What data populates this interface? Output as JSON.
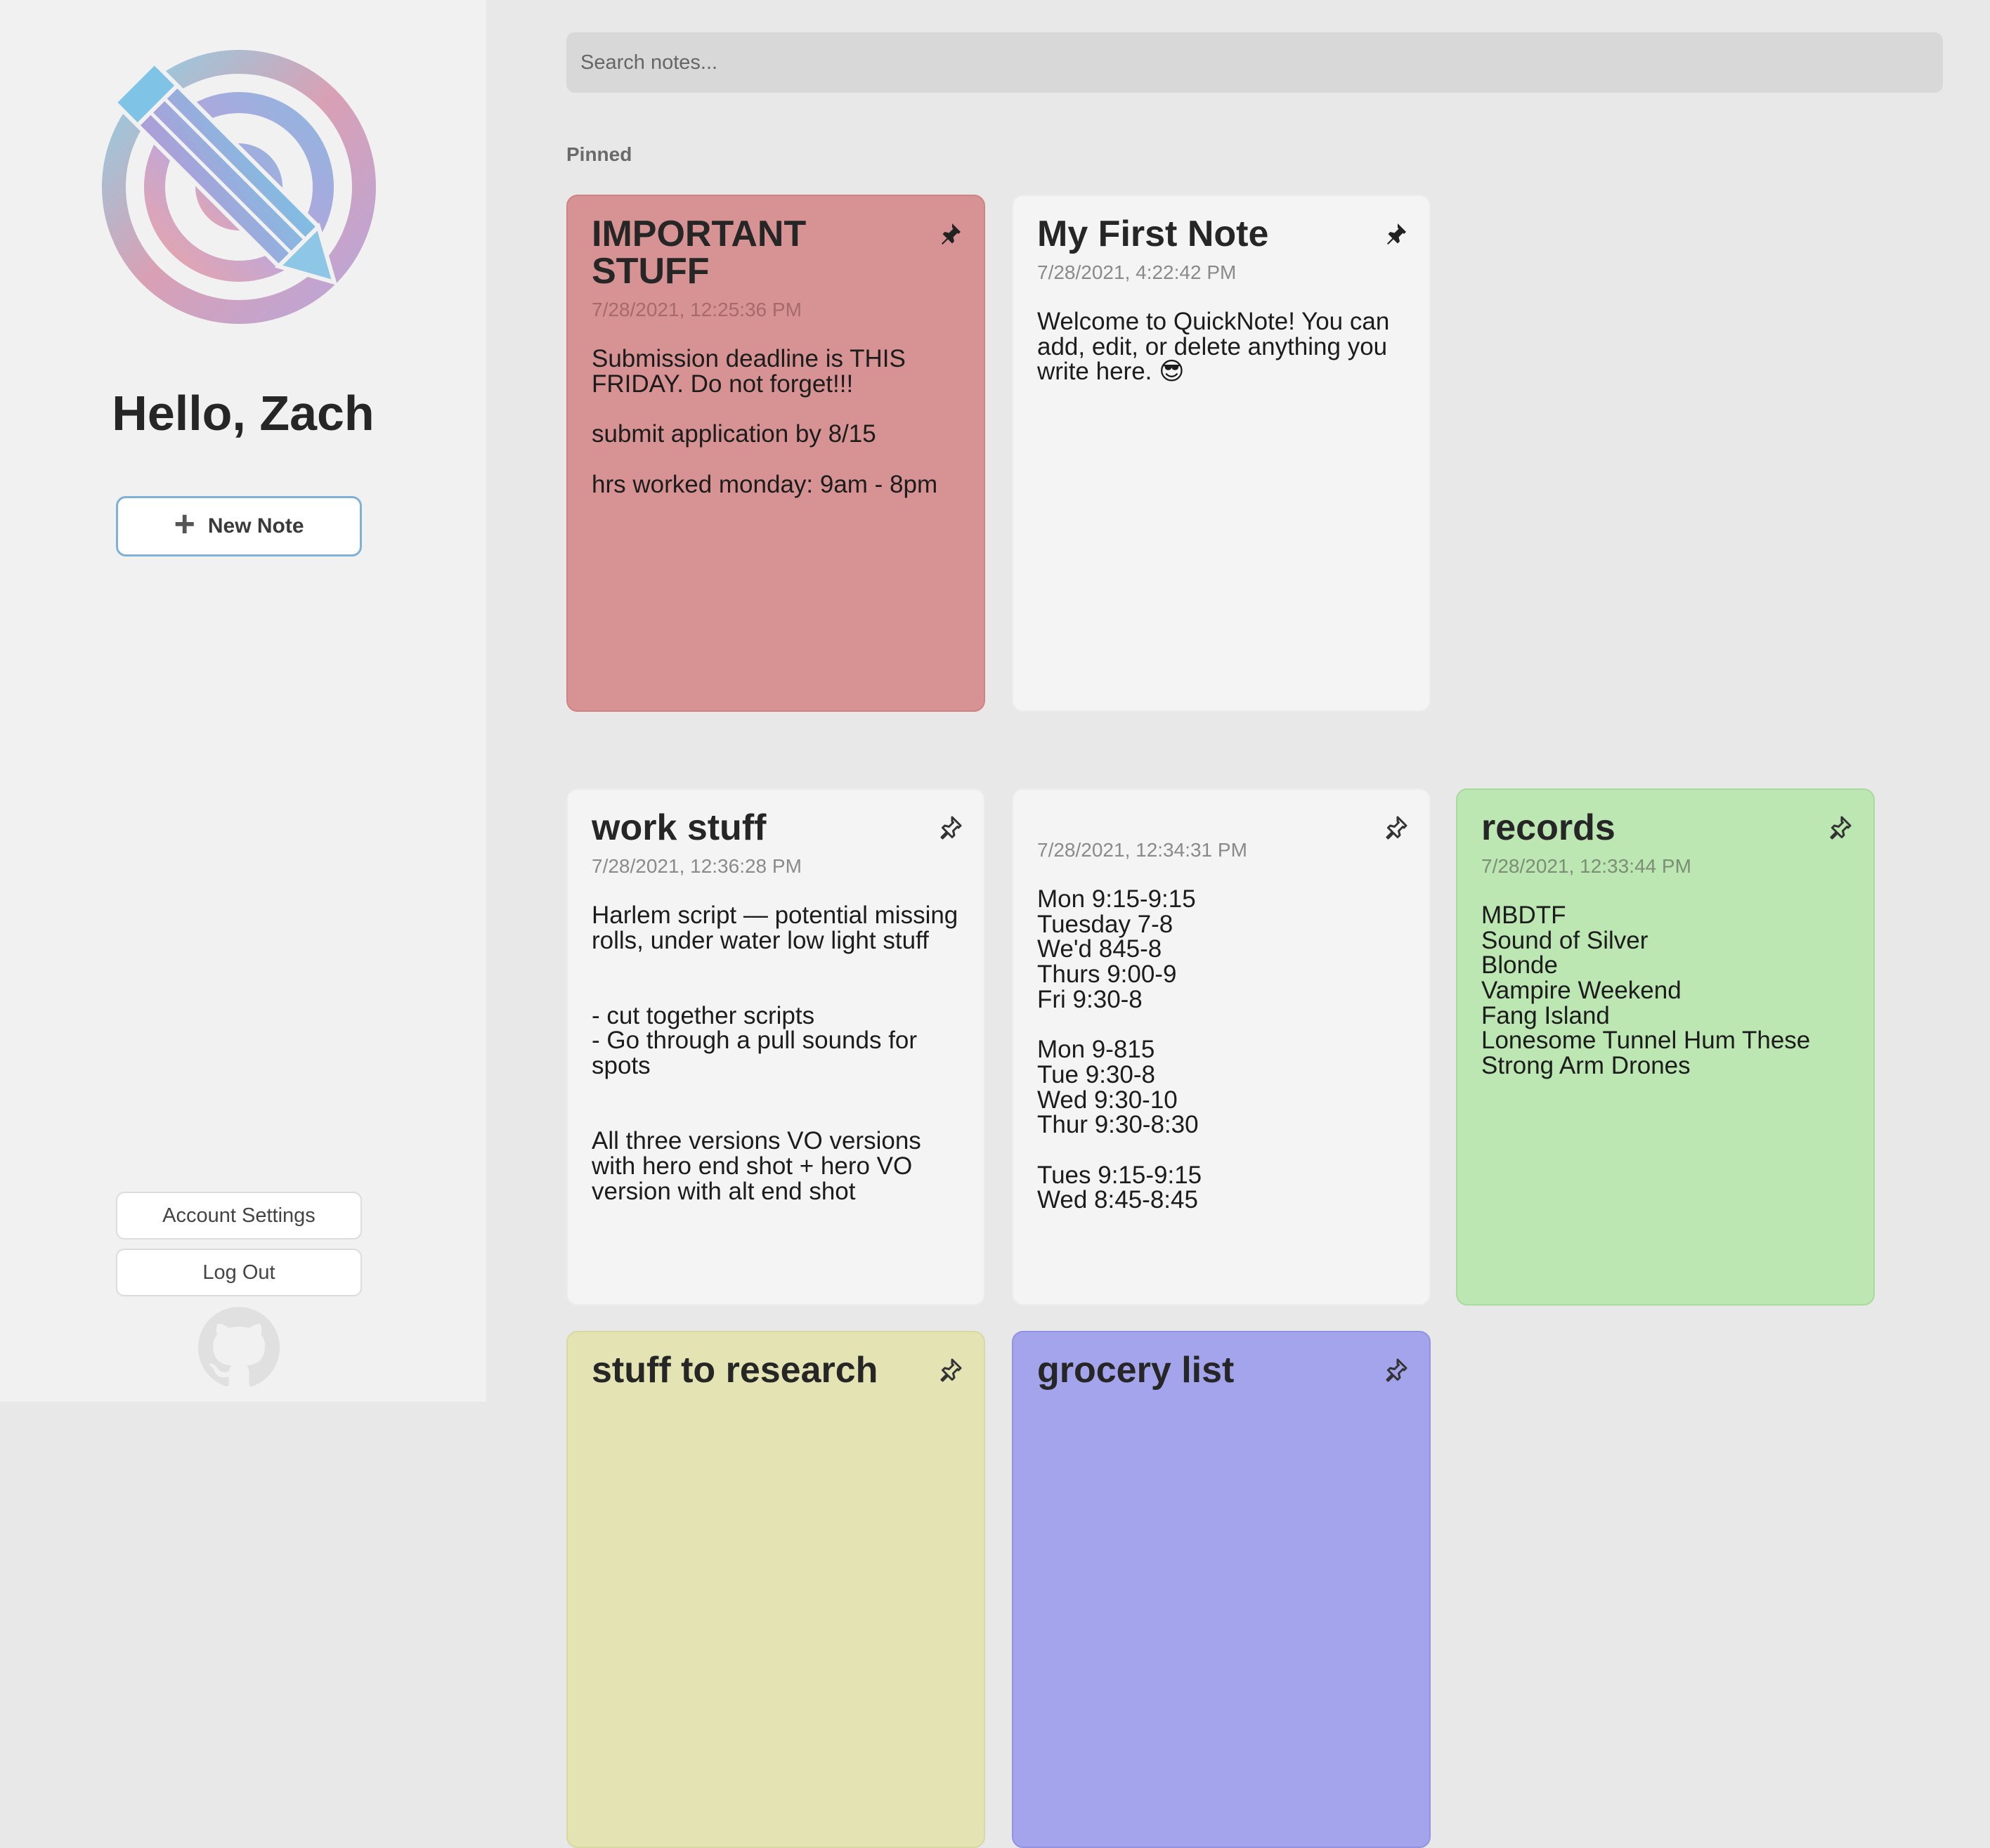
{
  "sidebar": {
    "greeting": "Hello, Zach",
    "new_note_label": "New Note",
    "account_settings_label": "Account Settings",
    "logout_label": "Log Out"
  },
  "search": {
    "placeholder": "Search notes..."
  },
  "sections": {
    "pinned_label": "Pinned"
  },
  "notes": [
    {
      "title": "IMPORTANT STUFF",
      "date": "7/28/2021, 12:25:36 PM",
      "body": "Submission deadline is THIS FRIDAY. Do not forget!!!\n\nsubmit application by 8/15\n\nhrs worked monday: 9am - 8pm",
      "pinned": true,
      "color": "#d79393"
    },
    {
      "title": "My First Note",
      "date": "7/28/2021, 4:22:42 PM",
      "body": "Welcome to QuickNote! You can add, edit, or delete anything you write here. 😎",
      "pinned": true,
      "color": "#f4f4f4"
    },
    {
      "title": "work stuff",
      "date": "7/28/2021, 12:36:28 PM",
      "body": "Harlem script — potential missing rolls, under water low light stuff\n\n\n- cut together scripts\n- Go through a pull sounds for spots\n\n\nAll three versions VO versions with hero end shot + hero VO version with alt end shot",
      "pinned": false,
      "color": "#f4f4f4"
    },
    {
      "title": "",
      "date": "7/28/2021, 12:34:31 PM",
      "body": "Mon 9:15-9:15\nTuesday 7-8\nWe'd 845-8\nThurs 9:00-9\nFri 9:30-8\n\nMon 9-815\nTue 9:30-8\nWed 9:30-10\nThur 9:30-8:30\n\nTues 9:15-9:15\nWed 8:45-8:45",
      "pinned": false,
      "color": "#f4f4f4"
    },
    {
      "title": "records",
      "date": "7/28/2021, 12:33:44 PM",
      "body": "MBDTF\nSound of Silver\nBlonde\nVampire Weekend\nFang Island\nLonesome Tunnel Hum These\nStrong Arm Drones",
      "pinned": false,
      "color": "#bce6b2"
    },
    {
      "title": "stuff to research",
      "date": "",
      "body": "",
      "pinned": false,
      "color": "#e3e3b3"
    },
    {
      "title": "grocery list",
      "date": "",
      "body": "",
      "pinned": false,
      "color": "#a3a4eb"
    }
  ]
}
